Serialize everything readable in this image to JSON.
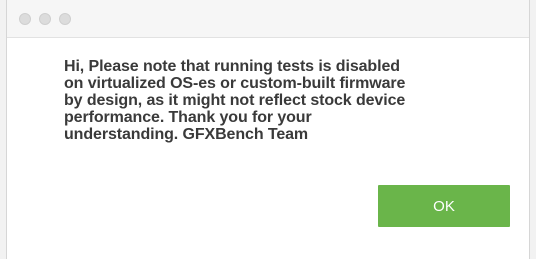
{
  "window": {
    "controls": [
      {
        "name": "close-button",
        "icon": "circle-icon"
      },
      {
        "name": "minimize-button",
        "icon": "circle-icon"
      },
      {
        "name": "zoom-button",
        "icon": "circle-icon"
      }
    ]
  },
  "dialog": {
    "message": "Hi, Please note that running tests is disabled\non virtualized OS-es or custom-built firmware\nby design, as it might not reflect stock device\nperformance. Thank you for your\nunderstanding. GFXBench Team",
    "ok_label": "OK"
  },
  "colors": {
    "accent": "#6ab54a",
    "text": "#3a3a3a"
  }
}
